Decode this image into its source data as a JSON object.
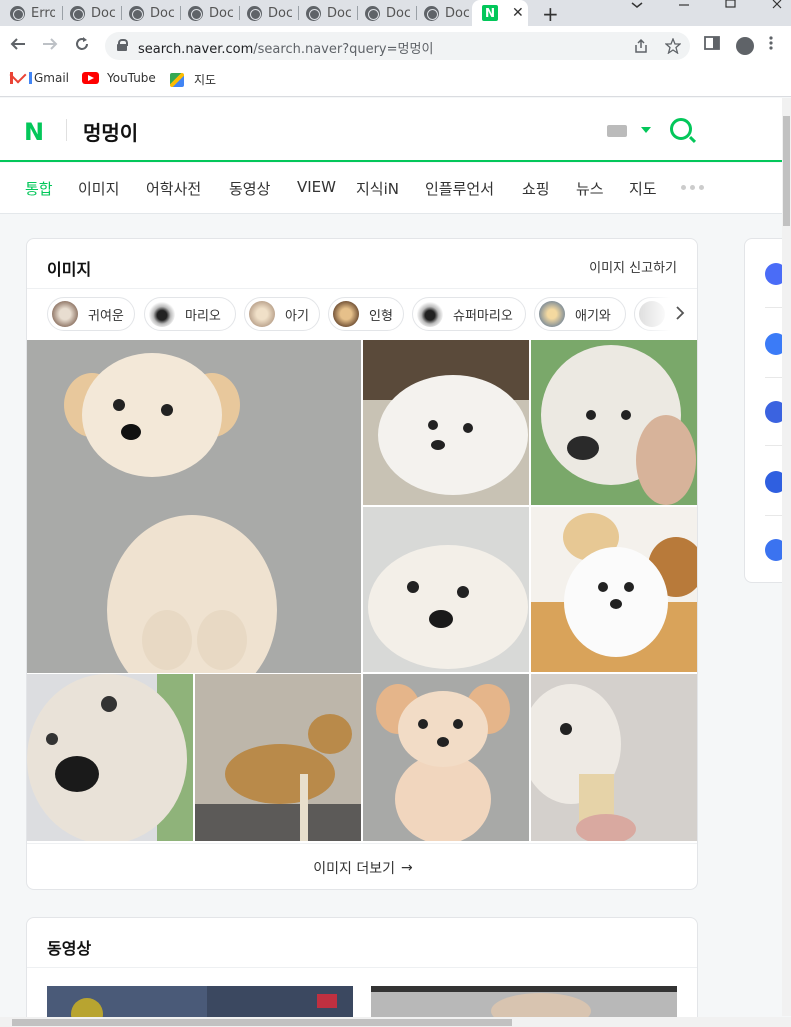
{
  "browser": {
    "tabs": [
      {
        "label": "Erro"
      },
      {
        "label": "Doc"
      },
      {
        "label": "Doc"
      },
      {
        "label": "Doc"
      },
      {
        "label": "Doc"
      },
      {
        "label": "Doc"
      },
      {
        "label": "Doc"
      },
      {
        "label": "Doc"
      }
    ],
    "active_tab_icon": "N",
    "close_icon": "✕",
    "new_tab_icon": "+",
    "url_host": "search.naver.com",
    "url_path": "/search.naver?query=멍멍이",
    "bookmarks": [
      {
        "label": "Gmail",
        "icon": "gmail-icon"
      },
      {
        "label": "YouTube",
        "icon": "youtube-icon"
      },
      {
        "label": "지도",
        "icon": "maps-icon"
      }
    ]
  },
  "naver": {
    "logo": "N",
    "query": "멍멍이",
    "accent": "#03c75a",
    "nav": [
      {
        "label": "통합",
        "active": true
      },
      {
        "label": "이미지"
      },
      {
        "label": "어학사전"
      },
      {
        "label": "동영상"
      },
      {
        "label": "VIEW"
      },
      {
        "label": "지식iN"
      },
      {
        "label": "인플루언서"
      },
      {
        "label": "쇼핑"
      },
      {
        "label": "뉴스"
      },
      {
        "label": "지도"
      }
    ]
  },
  "image_section": {
    "title": "이미지",
    "report": "이미지 신고하기",
    "chips": [
      {
        "label": "귀여운"
      },
      {
        "label": "마리오"
      },
      {
        "label": "아기"
      },
      {
        "label": "인형"
      },
      {
        "label": "슈퍼마리오"
      },
      {
        "label": "애기와"
      }
    ],
    "more": "이미지 더보기",
    "more_arrow": "→"
  },
  "video_section": {
    "title": "동영상"
  }
}
